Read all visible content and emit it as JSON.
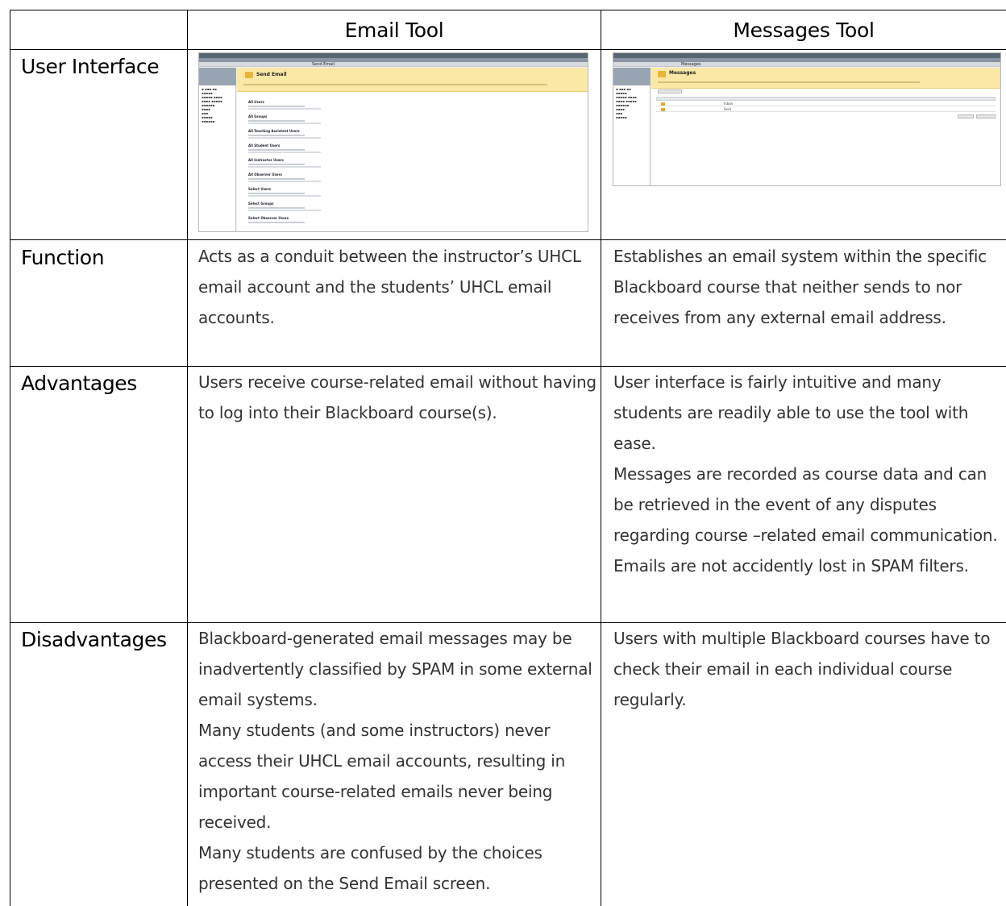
{
  "table": {
    "headers": {
      "col1": "",
      "col2": "Email Tool",
      "col3": "Messages Tool"
    },
    "rows": [
      {
        "label": "User Interface"
      },
      {
        "label": "Function",
        "email": [
          "Acts as a conduit between the instructor’s UHCL email account and the students’ UHCL email accounts."
        ],
        "messages": [
          "Establishes an email system within the specific Blackboard course that neither sends to nor receives from any external email address."
        ]
      },
      {
        "label": "Advantages",
        "email": [
          "Users receive course-related email without having to log into their Blackboard course(s)."
        ],
        "messages": [
          "User interface is fairly intuitive and many students are readily able to use the tool with ease.",
          "Messages are recorded as course data and can be retrieved in the event of any disputes regarding course –related email communication.",
          "Emails are not accidently lost in SPAM filters."
        ]
      },
      {
        "label": "Disadvantages",
        "email": [
          "Blackboard-generated email messages may be inadvertently classified by SPAM in some external email systems.",
          "Many students (and some instructors) never access their UHCL email accounts, resulting in important course-related emails never being received.",
          "Many students are confused by the choices presented on the Send Email screen."
        ],
        "messages": [
          "Users with multiple Blackboard courses have to check their email in each individual course regularly."
        ]
      }
    ]
  },
  "screenshots": {
    "email": {
      "breadcrumb": "Send Email",
      "title": "Send Email",
      "options": [
        "All Users",
        "All Groups",
        "All Teaching Assistant Users",
        "All Student Users",
        "All Instructor Users",
        "All Observer Users",
        "Select Users",
        "Select Groups",
        "Select Observer Users"
      ]
    },
    "messages": {
      "breadcrumb": "Messages",
      "title": "Messages",
      "folders": [
        "Inbox",
        "Sent"
      ]
    }
  }
}
